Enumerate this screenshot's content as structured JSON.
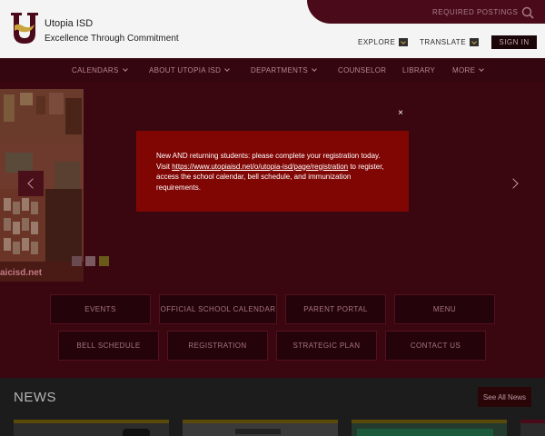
{
  "header": {
    "site_name": "Utopia ISD",
    "tagline": "Excellence Through Commitment",
    "required_postings": "REQUIRED POSTINGS",
    "explore": "EXPLORE",
    "translate": "TRANSLATE",
    "sign_in": "SIGN IN"
  },
  "nav": {
    "items": [
      {
        "label": "CALENDARS",
        "has_menu": true
      },
      {
        "label": "ABOUT UTOPIA ISD",
        "has_menu": true
      },
      {
        "label": "DEPARTMENTS",
        "has_menu": true
      },
      {
        "label": "COUNSELOR",
        "has_menu": false
      },
      {
        "label": "LIBRARY",
        "has_menu": false
      },
      {
        "label": "MORE",
        "has_menu": true
      }
    ]
  },
  "hero": {
    "photo_caption": "aicisd.net"
  },
  "alert": {
    "text_before": "New AND returning students: please complete your registration today. Visit ",
    "link": "https://www.utopiaisd.net/o/utopia-isd/page/registration",
    "text_after": " to register, access the school calendar, bell schedule, and immunization requirements.",
    "close": "×"
  },
  "quick_links": {
    "row1": [
      "EVENTS",
      "OFFICIAL SCHOOL CALENDAR",
      "PARENT PORTAL",
      "MENU"
    ],
    "row2": [
      "BELL SCHEDULE",
      "REGISTRATION",
      "STRATEGIC PLAN",
      "CONTACT US"
    ]
  },
  "news": {
    "title": "NEWS",
    "see_all": "See All News"
  },
  "colors": {
    "brand_maroon": "#34060f",
    "alert_red": "#800604",
    "gold": "#c9a43d"
  },
  "icons": [
    "logo-u-icon",
    "search-icon",
    "chevron-down-icon",
    "close-icon",
    "arrow-left-icon",
    "arrow-right-icon"
  ]
}
